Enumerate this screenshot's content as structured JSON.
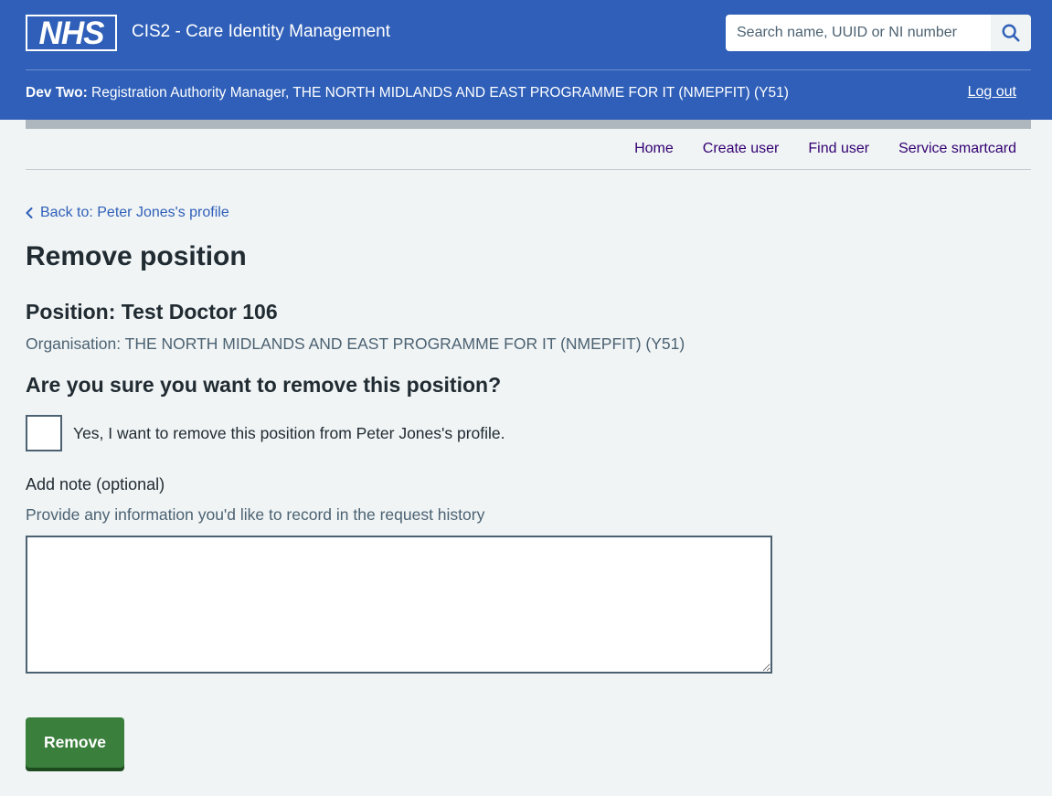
{
  "header": {
    "logo_text": "NHS",
    "service_name": "CIS2 - Care Identity Management",
    "search": {
      "placeholder": "Search name, UUID or NI number"
    },
    "user_bar": {
      "user_name": "Dev Two:",
      "role": " Registration Authority Manager, THE NORTH MIDLANDS AND EAST PROGRAMME FOR IT (NMEPFIT) (Y51)"
    },
    "logout_label": "Log out"
  },
  "nav": {
    "items": [
      {
        "label": "Home"
      },
      {
        "label": "Create user"
      },
      {
        "label": "Find user"
      },
      {
        "label": "Service smartcard"
      }
    ]
  },
  "main": {
    "back_link": "Back to: Peter Jones's profile",
    "title": "Remove position",
    "position": "Position: Test Doctor 106",
    "organisation": "Organisation: THE NORTH MIDLANDS AND EAST PROGRAMME FOR IT (NMEPFIT) (Y51)",
    "question": "Are you sure you want to remove this position?",
    "checkbox_label": "Yes, I want to remove this position from Peter Jones's profile.",
    "note_label": "Add note (optional)",
    "note_hint": "Provide any information you'd like to record in the request history",
    "note_value": "",
    "remove_label": "Remove"
  },
  "colors": {
    "brand_blue": "#2f5fb8",
    "button_green": "#3a7f3c",
    "nav_link": "#330072",
    "background": "#f0f4f5"
  },
  "icons": {
    "search": "search-icon",
    "back": "chevron-left-icon"
  }
}
